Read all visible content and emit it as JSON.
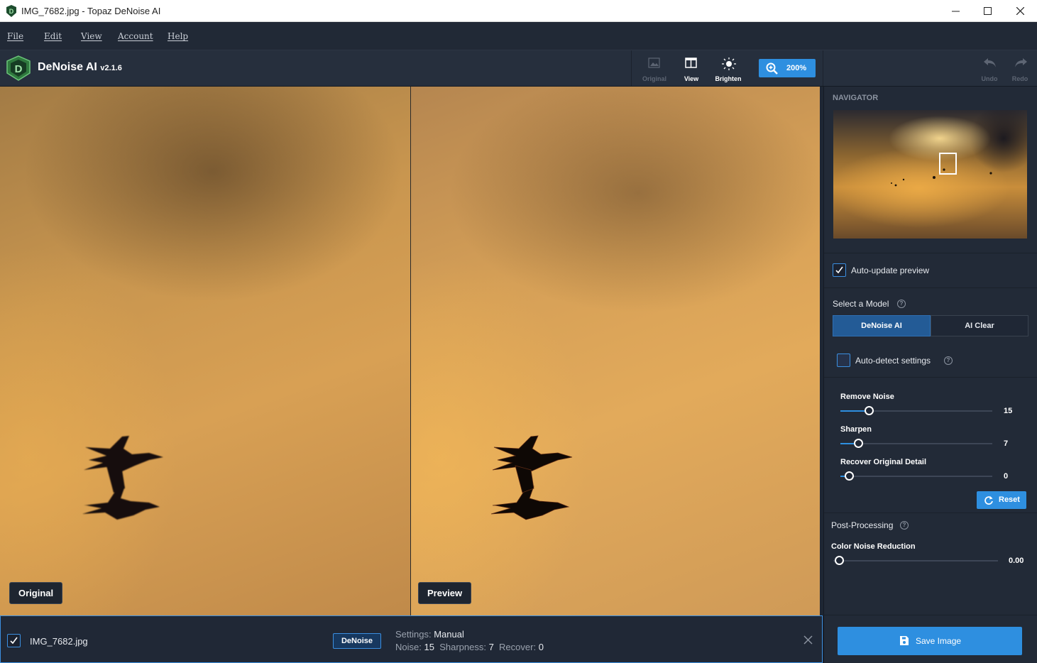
{
  "window": {
    "title": "IMG_7682.jpg - Topaz DeNoise AI",
    "minimize": "—",
    "maximize": "☐",
    "close": "✕"
  },
  "menu": [
    "File",
    "Edit",
    "View",
    "Account",
    "Help"
  ],
  "toolbar": {
    "app_name": "DeNoise AI",
    "version": "v2.1.6",
    "buttons": {
      "original": "Original",
      "view": "View",
      "brighten": "Brighten",
      "undo": "Undo",
      "redo": "Redo"
    },
    "zoom": "200%"
  },
  "viewer": {
    "left_label": "Original",
    "right_label": "Preview"
  },
  "panel": {
    "navigator_title": "NAVIGATOR",
    "auto_update": {
      "label": "Auto-update preview",
      "checked": true
    },
    "model": {
      "title": "Select a Model",
      "options": [
        "DeNoise AI",
        "AI Clear"
      ],
      "selected": "DeNoise AI"
    },
    "auto_detect": {
      "label": "Auto-detect settings",
      "checked": false
    },
    "sliders": [
      {
        "label": "Remove Noise",
        "value": "15",
        "fraction": 0.15
      },
      {
        "label": "Sharpen",
        "value": "7",
        "fraction": 0.07
      },
      {
        "label": "Recover Original Detail",
        "value": "0",
        "fraction": 0.0
      }
    ],
    "reset": "Reset",
    "post_processing": {
      "title": "Post-Processing",
      "slider_label": "Color Noise Reduction",
      "value": "0.00",
      "fraction": 0.0
    },
    "save": "Save Image"
  },
  "file": {
    "name": "IMG_7682.jpg",
    "badge": "DeNoise",
    "settings_label": "Settings:",
    "settings_value": "Manual",
    "noise_label": "Noise:",
    "noise_value": "15",
    "sharpness_label": "Sharpness:",
    "sharpness_value": "7",
    "recover_label": "Recover:",
    "recover_value": "0"
  },
  "colors": {
    "accent": "#2e8fe0",
    "panel": "#222a37",
    "toolbar": "#262f3d"
  }
}
